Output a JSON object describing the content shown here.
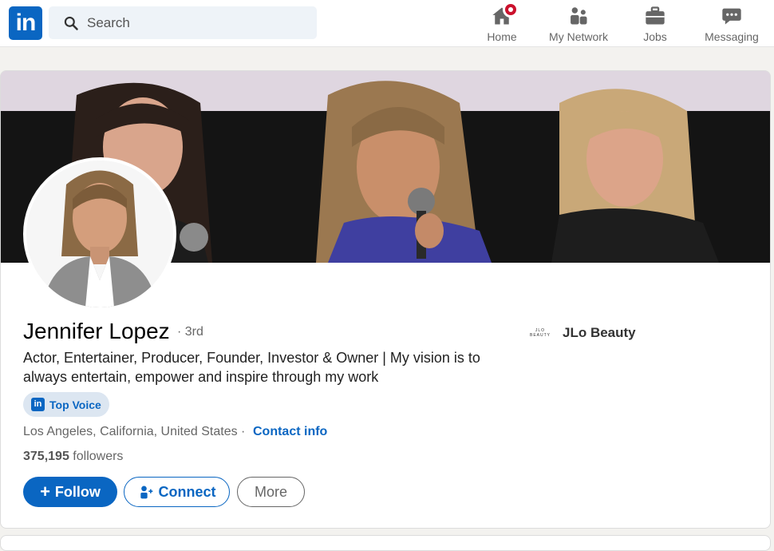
{
  "nav": {
    "logo_text": "in",
    "search_placeholder": "Search",
    "items": [
      {
        "label": "Home",
        "icon": "home-icon",
        "has_badge": true
      },
      {
        "label": "My Network",
        "icon": "network-icon"
      },
      {
        "label": "Jobs",
        "icon": "briefcase-icon"
      },
      {
        "label": "Messaging",
        "icon": "chat-icon"
      }
    ]
  },
  "profile": {
    "name": "Jennifer Lopez",
    "degree": "· 3rd",
    "headline": "Actor, Entertainer, Producer, Founder, Investor & Owner | My vision is to always entertain, empower and inspire through my work",
    "badge_label": "Top Voice",
    "location": "Los Angeles, California, United States ·",
    "contact_label": "Contact info",
    "followers_count": "375,195",
    "followers_label": "followers",
    "company_logo_text": "JLO BEAUTY",
    "company_name": "JLo Beauty"
  },
  "actions": {
    "follow_label": "Follow",
    "connect_label": "Connect",
    "more_label": "More"
  },
  "colors": {
    "brand": "#0a66c2",
    "badge_red": "#cb112d",
    "page_bg": "#f3f2ef"
  }
}
